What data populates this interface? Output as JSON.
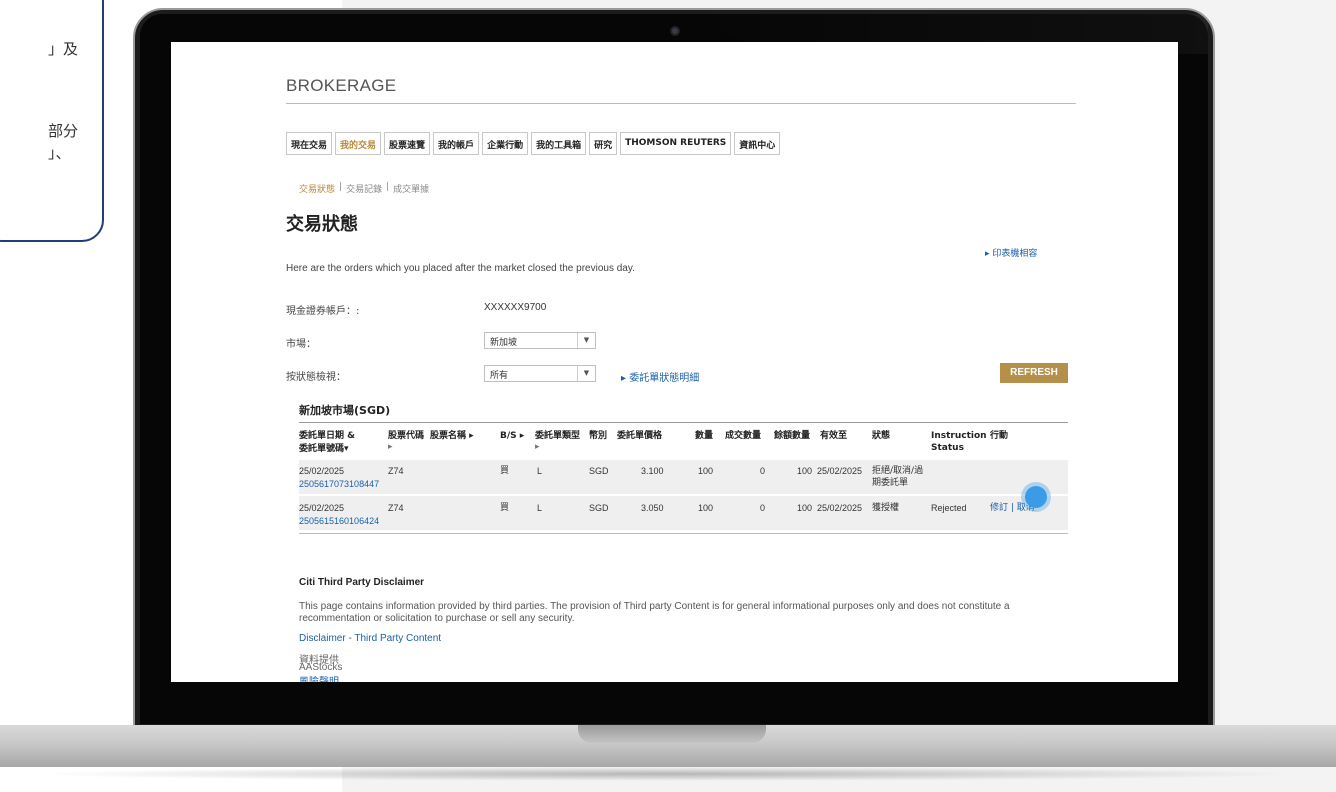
{
  "callout": {
    "line1": "」及",
    "line2": "部分",
    "line3": "」、"
  },
  "page": {
    "brand": "BROKERAGE",
    "tabs": [
      {
        "label": "現在交易",
        "active": false
      },
      {
        "label": "我的交易",
        "active": true
      },
      {
        "label": "股票速覽",
        "active": false
      },
      {
        "label": "我的帳戶",
        "active": false
      },
      {
        "label": "企業行動",
        "active": false
      },
      {
        "label": "我的工具箱",
        "active": false
      },
      {
        "label": "研究",
        "active": false
      },
      {
        "label": "THOMSON REUTERS",
        "active": false
      },
      {
        "label": "資訊中心",
        "active": false
      }
    ],
    "subnav": {
      "item1": "交易狀態",
      "sep": "|",
      "item2": "交易記錄",
      "item3": "成交單據"
    },
    "title": "交易狀態",
    "print_link": "▸ 印表機相容",
    "note": "Here are the orders which you placed after the market closed the previous day.",
    "account_label": "現金證券帳戶：:",
    "account_value": "XXXXXX9700",
    "market_label": "市場：",
    "market_value": "新加坡",
    "status_label": "按狀態檢視：",
    "status_value": "所有",
    "status_link": "▸ 委託單狀態明細",
    "refresh": "REFRESH",
    "section_title": "新加坡市場(SGD)"
  },
  "table": {
    "headers": {
      "date": "委託單日期 &",
      "date2": "委託單號碼▾",
      "code": "股票代碼",
      "name": "股票名稱 ▸",
      "name2": "▸",
      "bs": "B/S ▸",
      "type": "委託單類型",
      "type2": "▸",
      "currency": "幣別",
      "price": "委託單價格",
      "qty": "數量",
      "filled": "成交數量",
      "remain": "餘額數量",
      "valid": "有效至",
      "status": "狀態",
      "instr": "Instruction",
      "instr2": "Status",
      "action": "行動"
    },
    "rows": [
      {
        "date": "25/02/2025",
        "order_no": "2505617073108447",
        "code": "Z74",
        "bs": "買",
        "type": "L",
        "currency": "SGD",
        "price": "3.100",
        "qty": "100",
        "filled": "0",
        "remain": "100",
        "valid": "25/02/2025",
        "status": "拒絕/取消/過",
        "status2": "期委託單",
        "instr": "",
        "action": ""
      },
      {
        "date": "25/02/2025",
        "order_no": "2505615160106424",
        "code": "Z74",
        "bs": "買",
        "type": "L",
        "currency": "SGD",
        "price": "3.050",
        "qty": "100",
        "filled": "0",
        "remain": "100",
        "valid": "25/02/2025",
        "status": "獲授權",
        "status2": "",
        "instr": "Rejected",
        "action": "修訂 | 取消"
      }
    ]
  },
  "disclaimer": {
    "heading": "Citi Third Party Disclaimer",
    "text": "This page contains information provided by third parties. The provision of Third party Content is for general informational purposes only and does not constitute a recommentation or solicitation to purchase or sell any security.",
    "link": "Disclaimer - Third Party Content",
    "source_label": "資料提供",
    "source_name": "AAStocks",
    "risk_link": "風險聲明"
  }
}
